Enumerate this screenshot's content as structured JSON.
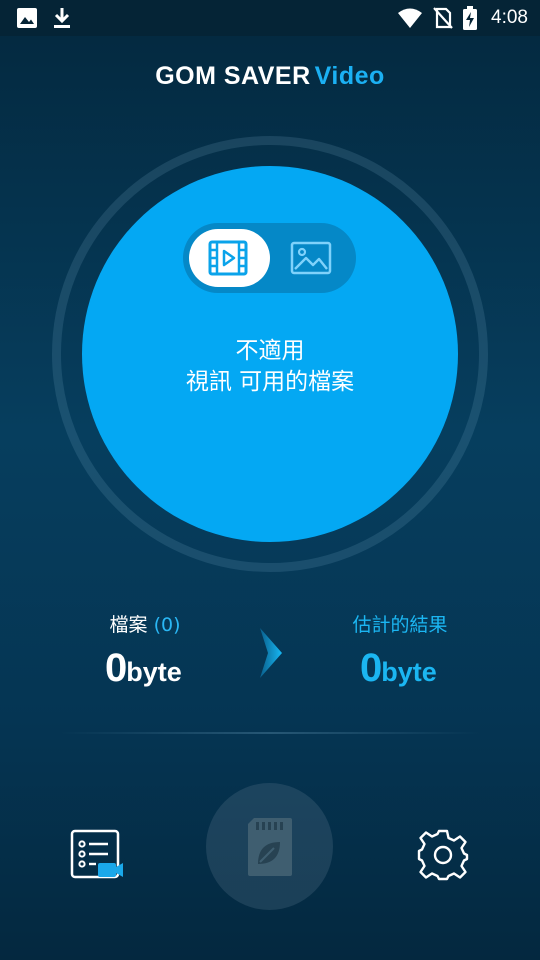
{
  "status_bar": {
    "time": "4:08",
    "left_icons": [
      "image-notification-icon",
      "download-icon"
    ],
    "right_icons": [
      "wifi-icon",
      "no-sim-icon",
      "battery-charging-icon"
    ]
  },
  "header": {
    "title_main": "GOM SAVER",
    "title_accent": "Video"
  },
  "mode_toggle": {
    "options": [
      "video",
      "image"
    ],
    "selected": "video"
  },
  "center_message": {
    "line1": "不適用",
    "line2": "視訊 可用的檔案"
  },
  "stats": {
    "files_label": "檔案",
    "files_count": "(0)",
    "files_size_num": "0",
    "files_size_unit": "byte",
    "estimate_label": "估計的結果",
    "estimate_size_num": "0",
    "estimate_size_unit": "byte"
  },
  "bottom_bar": {
    "icons": [
      "video-list-icon",
      "sd-card-leaf-icon",
      "settings-gear-icon"
    ]
  },
  "colors": {
    "accent": "#1bb0f3",
    "circle": "#04a8f3",
    "background": "#063e5e"
  }
}
